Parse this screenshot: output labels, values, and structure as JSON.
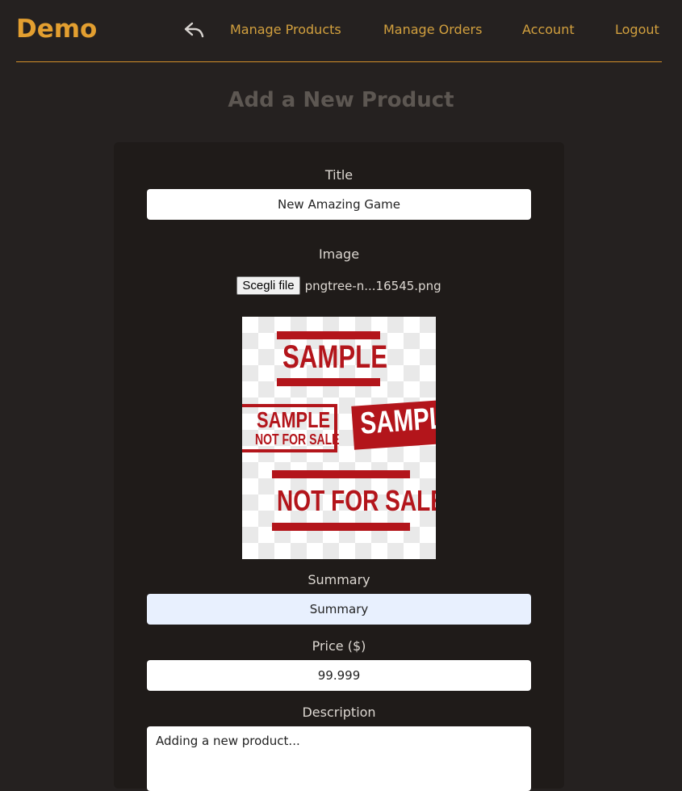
{
  "header": {
    "brand": "Demo",
    "back_icon": "reply-arrow-icon",
    "links": [
      {
        "label": "Manage Products"
      },
      {
        "label": "Manage Orders"
      },
      {
        "label": "Account"
      },
      {
        "label": "Logout"
      }
    ]
  },
  "colors": {
    "accent": "#e39f30",
    "background": "#252120",
    "card": "#1f1b19",
    "stamp_red": "#b3151b"
  },
  "page": {
    "title": "Add a New Product"
  },
  "form": {
    "title": {
      "label": "Title",
      "value": "New Amazing Game"
    },
    "image": {
      "label": "Image",
      "button_label": "Scegli file",
      "file_name": "pngtree-n...16545.png",
      "preview_texts": [
        "SAMPLE",
        "SAMPLE",
        "NOT FOR SALE",
        "SAMPLE",
        "NOT FOR SALE"
      ]
    },
    "summary": {
      "label": "Summary",
      "value": "Summary"
    },
    "price": {
      "label": "Price ($)",
      "value": "99.999"
    },
    "description": {
      "label": "Description",
      "value": "Adding a new product..."
    }
  }
}
